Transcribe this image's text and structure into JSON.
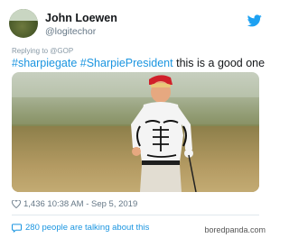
{
  "header": {
    "name": "John Loewen",
    "handle": "@logitechor",
    "icons": [
      "avatar",
      "twitter-bird-icon"
    ]
  },
  "tweet": {
    "reply_to": "Replying to @GOP",
    "hashtag_1": "#sharpiegate",
    "hashtag_2": "#SharpiePresident",
    "text_rest": " this is a good one",
    "likes": "1,436",
    "timestamp": "10:38 AM - Sep 5, 2019",
    "talking_about": "280 people are talking about this"
  },
  "watermark": "boredpanda.com",
  "colors": {
    "link": "#1b95e0",
    "text": "#14171a",
    "muted": "#657786",
    "divider": "#e1e8ed"
  }
}
